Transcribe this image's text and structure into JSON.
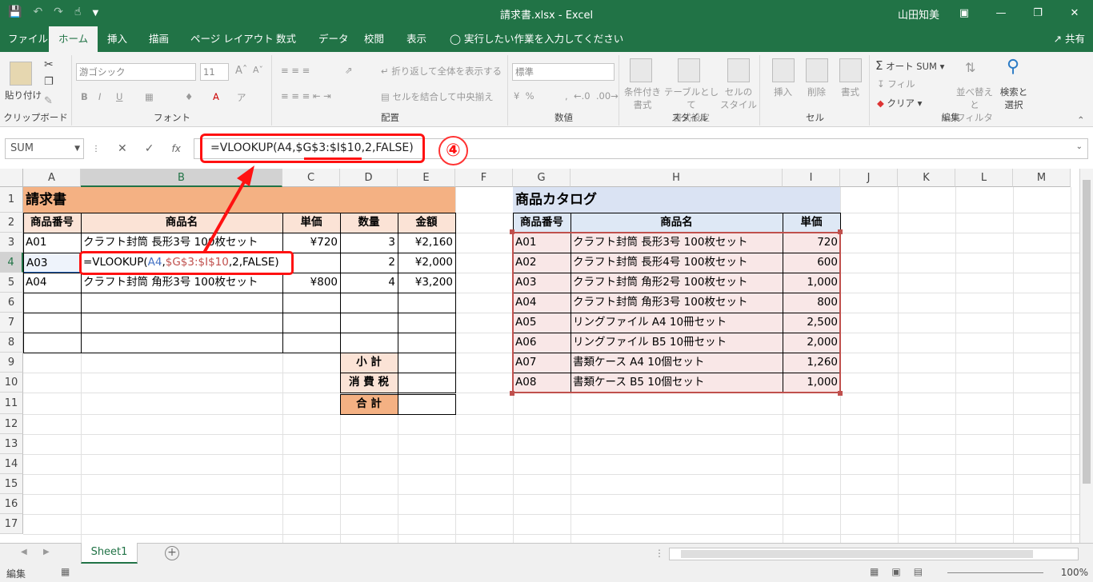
{
  "titlebar": {
    "filename": "請求書.xlsx",
    "separator": "-",
    "app": "Excel",
    "user": "山田知美"
  },
  "tabs": [
    "ファイル",
    "ホーム",
    "挿入",
    "描画",
    "ページ レイアウト",
    "数式",
    "データ",
    "校閲",
    "表示"
  ],
  "tell_me": "実行したい作業を入力してください",
  "share_label": "共有",
  "ribbon": {
    "clipboard": {
      "paste": "貼り付け",
      "label": "クリップボード"
    },
    "font": {
      "name": "游ゴシック",
      "size": "11",
      "label": "フォント"
    },
    "alignment": {
      "wrap": "折り返して全体を表示する",
      "merge": "セルを結合して中央揃え",
      "label": "配置"
    },
    "number": {
      "format": "標準",
      "label": "数値"
    },
    "styles": {
      "conditional": "条件付き\n書式",
      "table": "テーブルとして\n書式設定",
      "cell": "セルの\nスタイル",
      "label": "スタイル"
    },
    "cells": {
      "insert": "挿入",
      "delete": "削除",
      "format": "書式",
      "label": "セル"
    },
    "editing": {
      "autosum": "オート SUM",
      "fill": "フィル",
      "clear": "クリア",
      "sort": "並べ替えと\nフィルター",
      "find": "検索と\n選択",
      "label": "編集"
    }
  },
  "name_box": "SUM",
  "formula": "=VLOOKUP(A4,$G$3:$I$10,2,FALSE)",
  "annotation_number": "④",
  "columns": [
    "A",
    "B",
    "C",
    "D",
    "E",
    "F",
    "G",
    "H",
    "I",
    "J",
    "K",
    "L",
    "M"
  ],
  "rows": [
    "1",
    "2",
    "3",
    "4",
    "5",
    "6",
    "7",
    "8",
    "9",
    "10",
    "11",
    "12",
    "13",
    "14",
    "15",
    "16",
    "17"
  ],
  "invoice": {
    "title": "請求書",
    "headers": [
      "商品番号",
      "商品名",
      "単価",
      "数量",
      "金額"
    ],
    "rows": [
      {
        "code": "A01",
        "name": "クラフト封筒 長形3号 100枚セット",
        "price": "¥720",
        "qty": "3",
        "amount": "¥2,160"
      },
      {
        "code": "A03",
        "name": "",
        "price": "",
        "qty": "2",
        "amount": "¥2,000"
      },
      {
        "code": "A04",
        "name": "クラフト封筒 角形3号 100枚セット",
        "price": "¥800",
        "qty": "4",
        "amount": "¥3,200"
      }
    ],
    "formula_parts": {
      "a": "=VLOOKUP(",
      "b": "A4",
      "c": ",",
      "d": "$G$3:$I$10",
      "e": ",2,FALSE)"
    },
    "subtotal": "小 計",
    "tax": "消 費 税",
    "total": "合 計"
  },
  "catalog": {
    "title": "商品カタログ",
    "headers": [
      "商品番号",
      "商品名",
      "単価"
    ],
    "rows": [
      {
        "code": "A01",
        "name": "クラフト封筒 長形3号 100枚セット",
        "price": "720"
      },
      {
        "code": "A02",
        "name": "クラフト封筒 長形4号 100枚セット",
        "price": "600"
      },
      {
        "code": "A03",
        "name": "クラフト封筒 角形2号 100枚セット",
        "price": "1,000"
      },
      {
        "code": "A04",
        "name": "クラフト封筒 角形3号 100枚セット",
        "price": "800"
      },
      {
        "code": "A05",
        "name": "リングファイル A4 10冊セット",
        "price": "2,500"
      },
      {
        "code": "A06",
        "name": "リングファイル B5 10冊セット",
        "price": "2,000"
      },
      {
        "code": "A07",
        "name": "書類ケース A4 10個セット",
        "price": "1,260"
      },
      {
        "code": "A08",
        "name": "書類ケース B5 10個セット",
        "price": "1,000"
      }
    ]
  },
  "sheet_tab": "Sheet1",
  "status": {
    "mode": "編集",
    "zoom": "100%"
  },
  "colors": {
    "accent": "#217346",
    "invoice_title_bg": "#f4b183",
    "invoice_header_bg": "#fbe3d6",
    "catalog_title_bg": "#dae3f3",
    "catalog_header_bg": "#dee8f5",
    "catalog_row_bg": "#f9e7e7",
    "ref_blue": "#4472c4",
    "ref_red": "#c0504d",
    "annotation_red": "#ff1111"
  }
}
